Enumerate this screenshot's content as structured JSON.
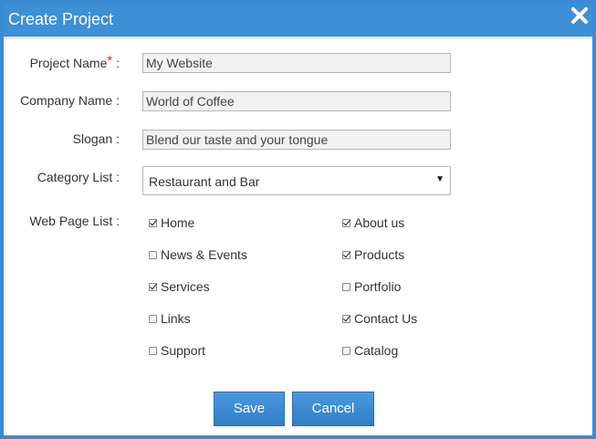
{
  "dialog": {
    "title": "Create Project",
    "close_icon": "close-icon"
  },
  "form": {
    "project_name": {
      "label": "Project Name",
      "required_mark": "*",
      "suffix": " :",
      "value": "My Website"
    },
    "company_name": {
      "label": "Company Name :",
      "value": "World of Coffee"
    },
    "slogan": {
      "label": "Slogan :",
      "value": "Blend our taste and your tongue"
    },
    "category": {
      "label": "Category List :",
      "selected": "Restaurant and Bar",
      "arrow": "▼"
    },
    "web_pages": {
      "label": "Web Page List :",
      "items": [
        {
          "label": "Home",
          "checked": true
        },
        {
          "label": "About us",
          "checked": true
        },
        {
          "label": "News & Events",
          "checked": false
        },
        {
          "label": "Products",
          "checked": true
        },
        {
          "label": "Services",
          "checked": true
        },
        {
          "label": "Portfolio",
          "checked": false
        },
        {
          "label": "Links",
          "checked": false
        },
        {
          "label": "Contact Us",
          "checked": true
        },
        {
          "label": "Support",
          "checked": false
        },
        {
          "label": "Catalog",
          "checked": false
        }
      ]
    }
  },
  "buttons": {
    "save": "Save",
    "cancel": "Cancel"
  },
  "colors": {
    "title_bar": "#3d8fd6",
    "button": "#3a8bd4",
    "required": "#e02020"
  }
}
